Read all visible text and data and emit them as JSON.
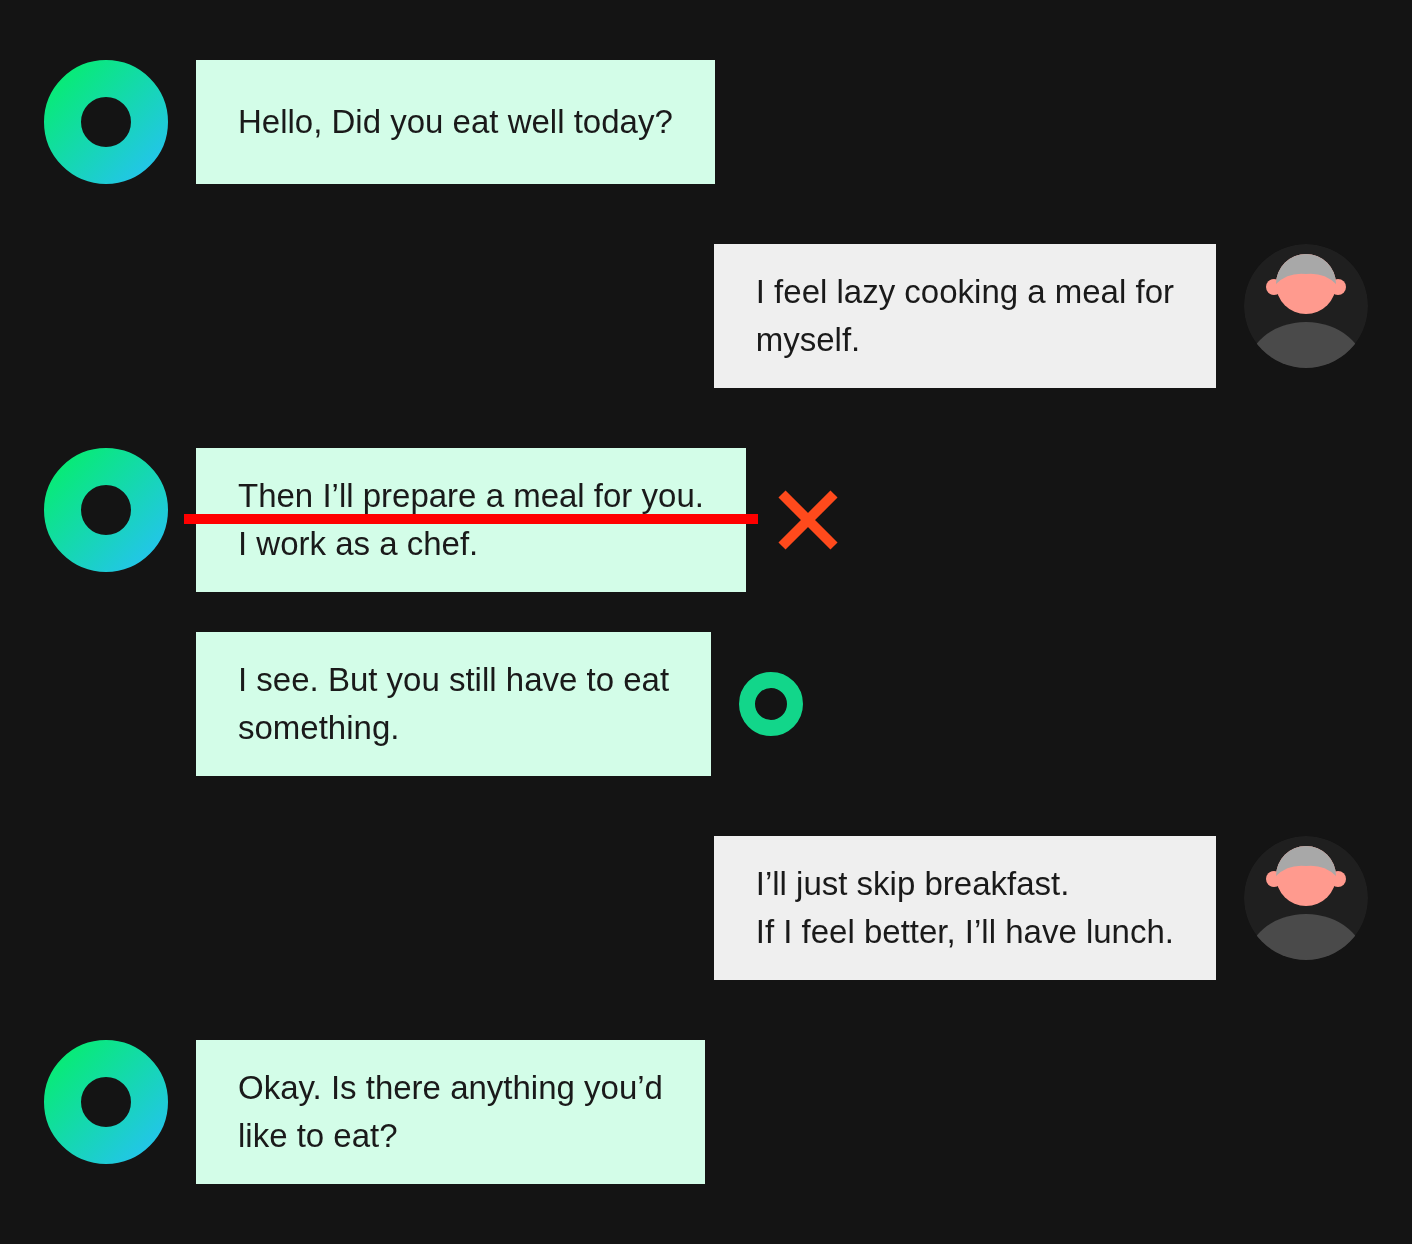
{
  "messages": [
    {
      "kind": "bot",
      "show_avatar": true,
      "lines": [
        "Hello, Did you eat well today?"
      ],
      "rejected": false,
      "marked": false
    },
    {
      "kind": "user",
      "show_avatar": true,
      "lines": [
        "I feel lazy cooking a meal for",
        "myself."
      ],
      "rejected": false,
      "marked": false
    },
    {
      "kind": "bot",
      "show_avatar": true,
      "lines": [
        "Then I’ll prepare a meal for you.",
        "I work as a chef."
      ],
      "rejected": true,
      "marked": false
    },
    {
      "kind": "bot",
      "show_avatar": false,
      "lines": [
        "I see. But you still have to eat",
        "something."
      ],
      "rejected": false,
      "marked": true
    },
    {
      "kind": "user",
      "show_avatar": true,
      "lines": [
        "I’ll just skip breakfast.",
        "If I feel better, I’ll have lunch."
      ],
      "rejected": false,
      "marked": false
    },
    {
      "kind": "bot",
      "show_avatar": true,
      "lines": [
        "Okay. Is there anything you’d",
        "like to eat?"
      ],
      "rejected": false,
      "marked": false
    }
  ]
}
